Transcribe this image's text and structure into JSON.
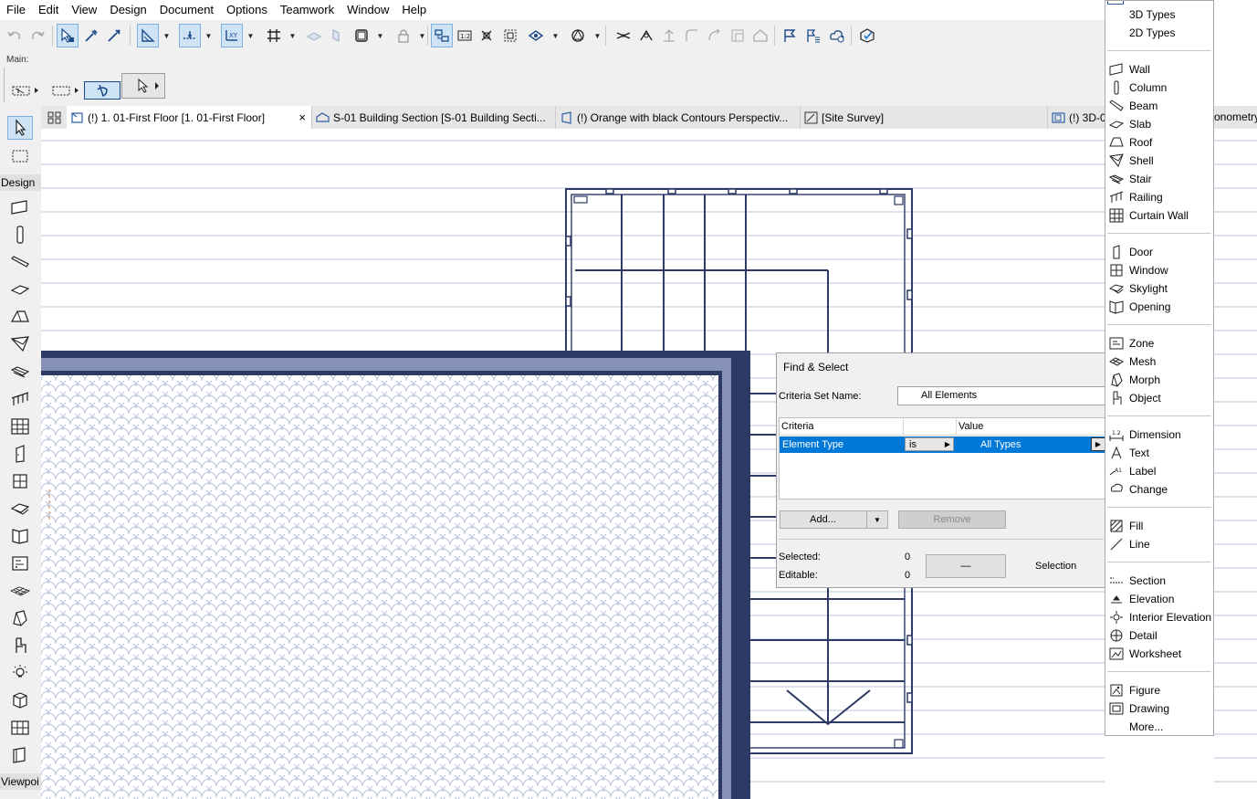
{
  "menubar": [
    "File",
    "Edit",
    "View",
    "Design",
    "Document",
    "Options",
    "Teamwork",
    "Window",
    "Help"
  ],
  "infobox": {
    "label": "Main:"
  },
  "tabs": [
    {
      "label": "(!) 1. 01-First Floor [1. 01-First Floor]",
      "close": "×"
    },
    {
      "label": "S-01 Building Section [S-01 Building Secti..."
    },
    {
      "label": "(!) Orange with black Contours Perspectiv..."
    },
    {
      "label": "[Site Survey]"
    },
    {
      "label": "(!) 3D-0"
    }
  ],
  "right_strip_tab": "onometry",
  "toolbox": {
    "design_label": "Design",
    "viewpoint_label": "Viewpoi"
  },
  "dialog": {
    "title": "Find & Select",
    "criteria_set_label": "Criteria Set Name:",
    "criteria_set_value": "All Elements",
    "col_criteria": "Criteria",
    "col_value": "Value",
    "row": {
      "criteria": "Element Type",
      "operator": "is",
      "value": "All Types"
    },
    "add_label": "Add...",
    "remove_label": "Remove",
    "selected_label": "Selected:",
    "selected_value": "0",
    "editable_label": "Editable:",
    "editable_value": "0",
    "minus_label": "—",
    "selection_label": "Selection"
  },
  "popup": {
    "groups": [
      [
        "3D Types",
        "2D Types"
      ],
      [
        "Wall",
        "Column",
        "Beam",
        "Slab",
        "Roof",
        "Shell",
        "Stair",
        "Railing",
        "Curtain Wall"
      ],
      [
        "Door",
        "Window",
        "Skylight",
        "Opening"
      ],
      [
        "Zone",
        "Mesh",
        "Morph",
        "Object"
      ],
      [
        "Dimension",
        "Text",
        "Label",
        "Change"
      ],
      [
        "Fill",
        "Line"
      ],
      [
        "Section",
        "Elevation",
        "Interior Elevation",
        "Detail",
        "Worksheet"
      ],
      [
        "Figure",
        "Drawing",
        "More..."
      ]
    ]
  },
  "colors": {
    "accent": "#0078d7",
    "plan_line": "#2d3a66",
    "wall_fill": "#8592b5",
    "grid_line": "#c8d0e4"
  }
}
